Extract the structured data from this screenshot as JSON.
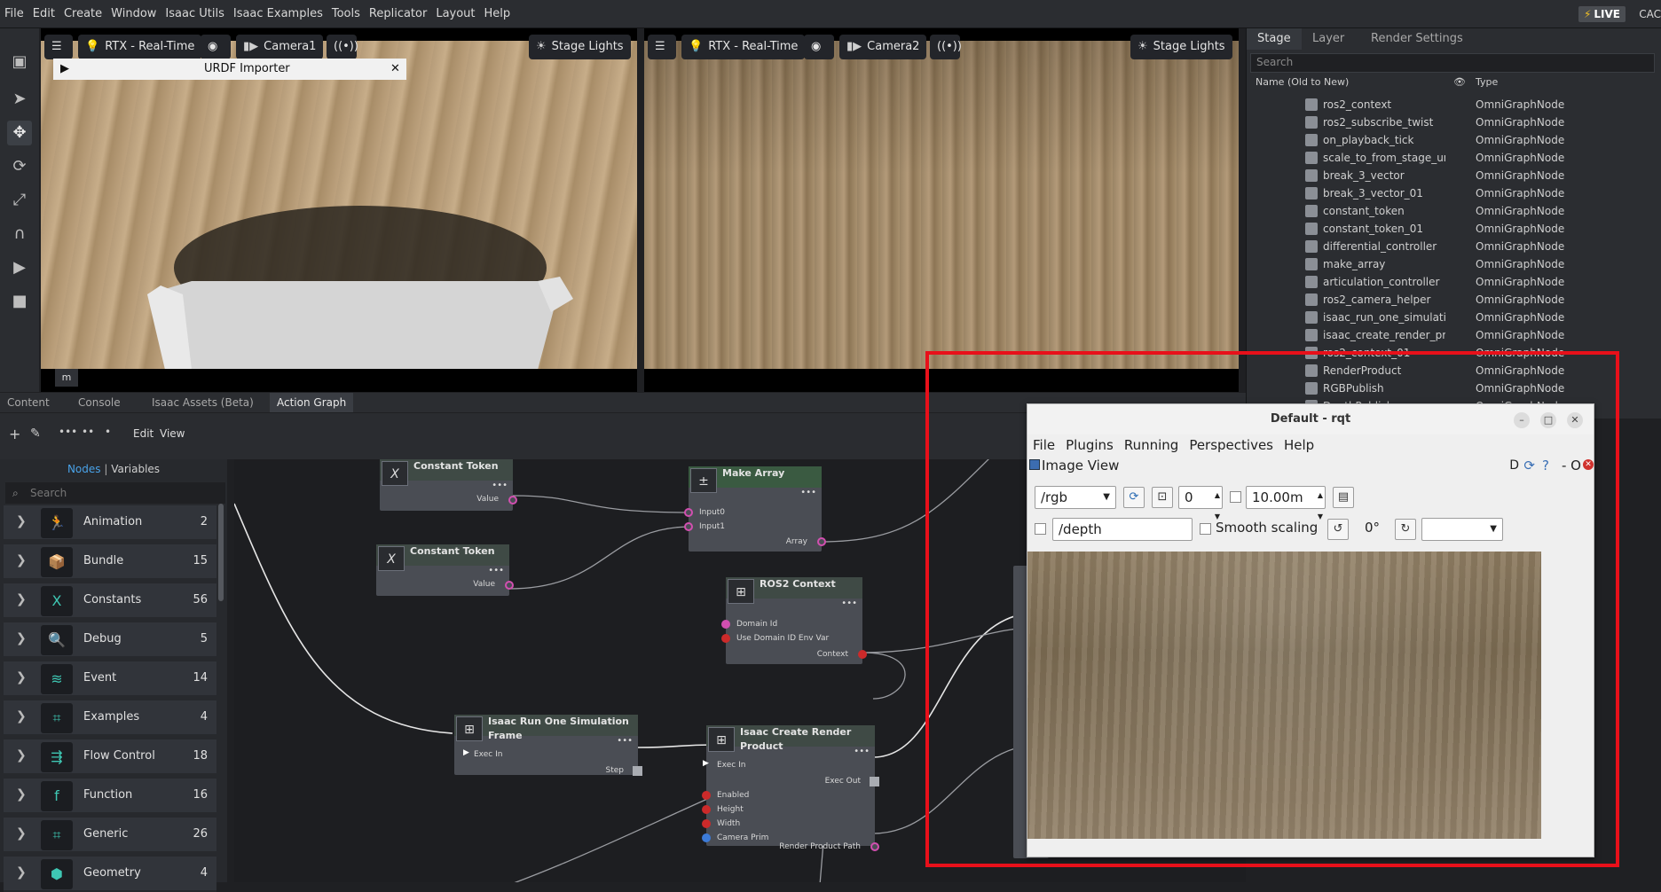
{
  "menubar": {
    "items": [
      "File",
      "Edit",
      "Create",
      "Window",
      "Isaac Utils",
      "Isaac Examples",
      "Tools",
      "Replicator",
      "Layout",
      "Help"
    ],
    "live_label": "LIVE",
    "right_text": "CAC"
  },
  "viewport1": {
    "settings_icon": "sliders-icon",
    "render_mode": "RTX - Real-Time",
    "camera": "Camera1",
    "lights": "Stage Lights",
    "urdf_panel_title": "URDF Importer",
    "scale_label": "m"
  },
  "viewport2": {
    "render_mode": "RTX - Real-Time",
    "camera": "Camera2",
    "lights": "Stage Lights"
  },
  "stage": {
    "tabs": [
      "Stage",
      "Layer",
      "Render Settings"
    ],
    "search_placeholder": "Search",
    "col_name": "Name (Old to New)",
    "col_type": "Type",
    "rows": [
      {
        "name": "ros2_context",
        "type": "OmniGraphNode"
      },
      {
        "name": "ros2_subscribe_twist",
        "type": "OmniGraphNode"
      },
      {
        "name": "on_playback_tick",
        "type": "OmniGraphNode"
      },
      {
        "name": "scale_to_from_stage_units",
        "type": "OmniGraphNode"
      },
      {
        "name": "break_3_vector",
        "type": "OmniGraphNode"
      },
      {
        "name": "break_3_vector_01",
        "type": "OmniGraphNode"
      },
      {
        "name": "constant_token",
        "type": "OmniGraphNode"
      },
      {
        "name": "constant_token_01",
        "type": "OmniGraphNode"
      },
      {
        "name": "differential_controller",
        "type": "OmniGraphNode"
      },
      {
        "name": "make_array",
        "type": "OmniGraphNode"
      },
      {
        "name": "articulation_controller",
        "type": "OmniGraphNode"
      },
      {
        "name": "ros2_camera_helper",
        "type": "OmniGraphNode"
      },
      {
        "name": "isaac_run_one_simulation_",
        "type": "OmniGraphNode"
      },
      {
        "name": "isaac_create_render_produc",
        "type": "OmniGraphNode"
      },
      {
        "name": "ros2_context_01",
        "type": "OmniGraphNode"
      },
      {
        "name": "RenderProduct",
        "type": "OmniGraphNode"
      },
      {
        "name": "RGBPublish",
        "type": "OmniGraphNode"
      },
      {
        "name": "DepthPublish",
        "type": "OmniGraphNode"
      }
    ]
  },
  "bottom_tabs": [
    "Content",
    "Console",
    "Isaac Assets (Beta)",
    "Action Graph"
  ],
  "action_graph": {
    "menu": [
      "Edit",
      "View"
    ],
    "panel_tabs": {
      "nodes": "Nodes",
      "variables": "Variables"
    },
    "search_placeholder": "Search",
    "categories": [
      {
        "name": "Animation",
        "count": "2",
        "icon": "animation-icon"
      },
      {
        "name": "Bundle",
        "count": "15",
        "icon": "bundle-icon"
      },
      {
        "name": "Constants",
        "count": "56",
        "icon": "constants-icon"
      },
      {
        "name": "Debug",
        "count": "5",
        "icon": "debug-icon"
      },
      {
        "name": "Event",
        "count": "14",
        "icon": "event-icon"
      },
      {
        "name": "Examples",
        "count": "4",
        "icon": "examples-icon"
      },
      {
        "name": "Flow Control",
        "count": "18",
        "icon": "flow-control-icon"
      },
      {
        "name": "Function",
        "count": "16",
        "icon": "function-icon"
      },
      {
        "name": "Generic",
        "count": "26",
        "icon": "generic-icon"
      },
      {
        "name": "Geometry",
        "count": "4",
        "icon": "geometry-icon"
      }
    ],
    "nodes": {
      "constant_token_1": {
        "title": "Constant Token",
        "port_value": "Value"
      },
      "constant_token_2": {
        "title": "Constant Token",
        "port_value": "Value"
      },
      "make_array": {
        "title": "Make Array",
        "in0": "Input0",
        "in1": "Input1",
        "out": "Array"
      },
      "ros2_context": {
        "title": "ROS2 Context",
        "in_domain": "Domain Id",
        "in_env": "Use Domain ID Env Var",
        "out": "Context"
      },
      "run_frame": {
        "title": "Isaac Run One Simulation Frame",
        "in_exec": "Exec In",
        "out_step": "Step"
      },
      "render_product": {
        "title": "Isaac Create Render Product",
        "in_exec": "Exec In",
        "enabled": "Enabled",
        "height": "Height",
        "width": "Width",
        "camera_prim": "Camera Prim",
        "exec_out": "Exec Out",
        "rpp": "Render Product Path"
      }
    }
  },
  "rqt": {
    "title": "Default - rqt",
    "menu": [
      "File",
      "Plugins",
      "Running",
      "Perspectives",
      "Help"
    ],
    "plugin_title": "Image View",
    "plugin_flags": "D",
    "plugin_dash": "- O",
    "topic": "/rgb",
    "spin_value": "0",
    "max_range": "10.00m",
    "depth_topic": "/depth",
    "smooth_label": "Smooth scaling",
    "rotation": "0°"
  }
}
